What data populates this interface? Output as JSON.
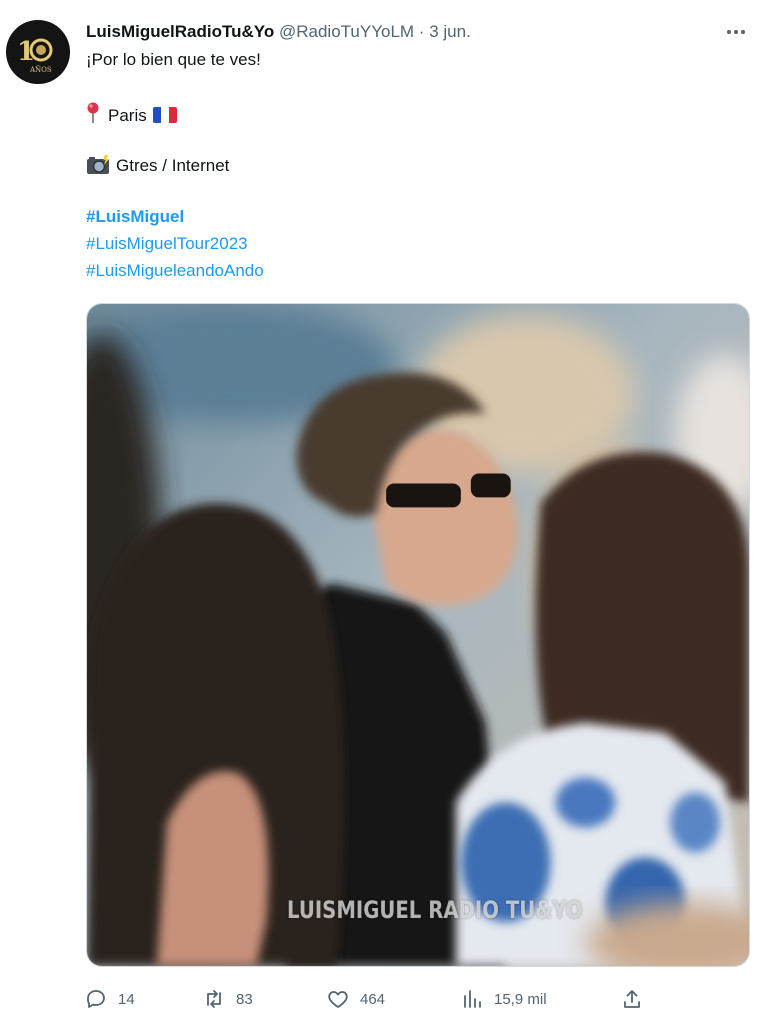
{
  "tweet": {
    "display_name": "LuisMiguelRadioTu&Yo",
    "handle": "@RadioTuYYoLM",
    "separator": "·",
    "date": "3 jun.",
    "text_line1": "¡Por lo bien que te ves!",
    "location_text": "Paris",
    "credit_text": "Gtres / Internet",
    "hashtags": [
      "#LuisMiguel",
      "#LuisMiguelTour2023",
      "#LuisMigueleandoAndo"
    ],
    "avatar_text": "10",
    "avatar_subtext": "AÑOS",
    "media": {
      "watermark": "LUISMIGUEL RADIO TU&YO"
    },
    "actions": {
      "replies": "14",
      "retweets": "83",
      "likes": "464",
      "views": "15,9 mil"
    }
  },
  "icons": {
    "location": "round-pushpin-icon",
    "flag": "france-flag-icon",
    "camera": "camera-flash-icon",
    "reply": "reply-icon",
    "retweet": "retweet-icon",
    "like": "heart-icon",
    "views": "views-chart-icon",
    "share": "share-icon",
    "more": "more-options-icon"
  },
  "colors": {
    "link": "#1d9bf0",
    "muted": "#536471",
    "text": "#0f1419"
  }
}
